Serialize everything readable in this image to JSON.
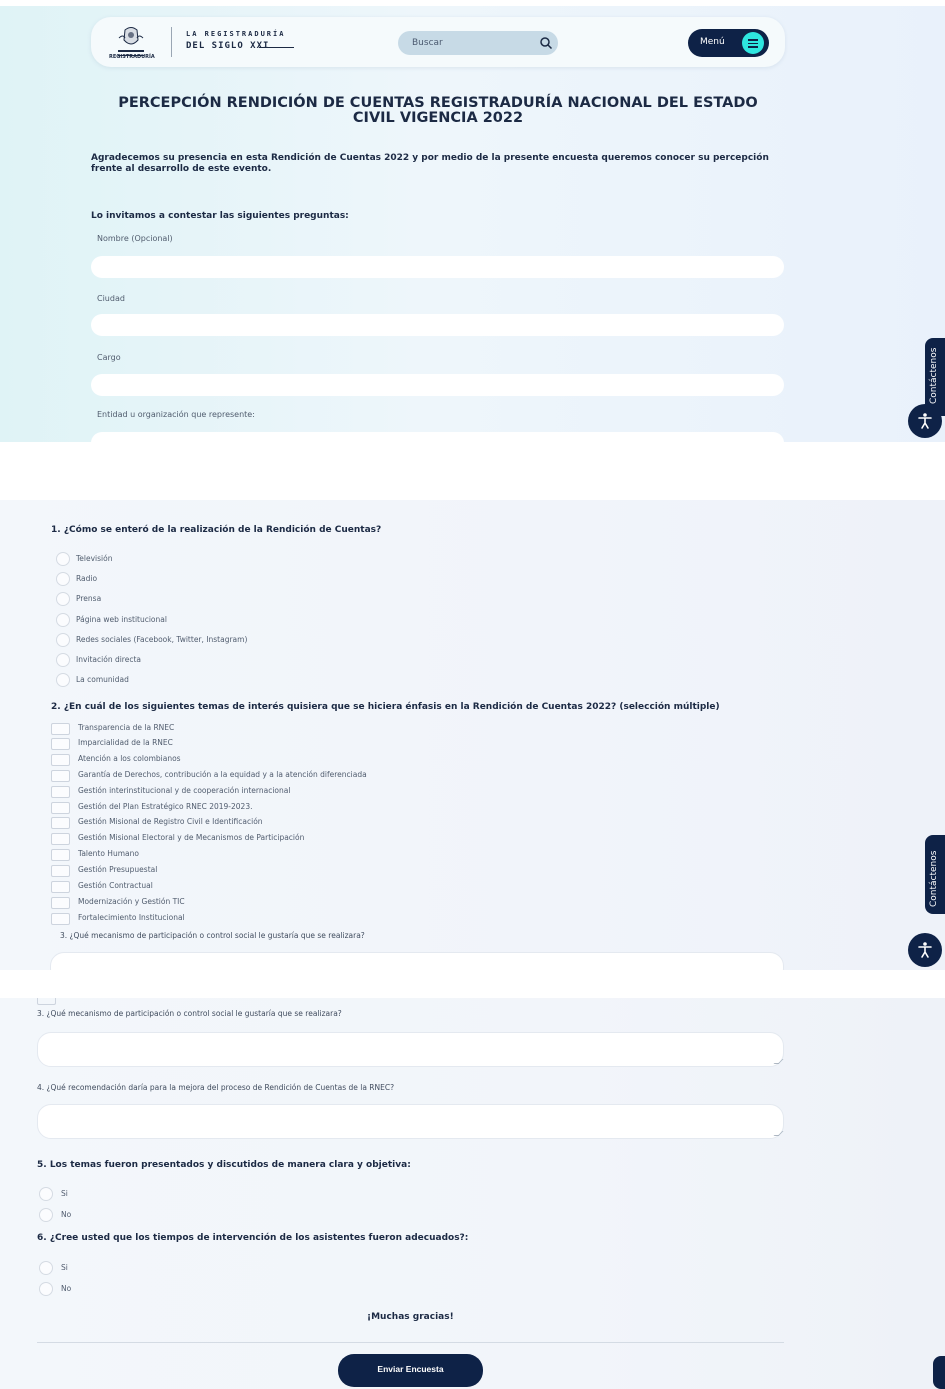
{
  "header": {
    "logo_small_text": "REGISTRADURÍA",
    "logo_line1": "LA REGISTRADURÍA",
    "logo_line2": "DEL SIGLO XXI",
    "search_placeholder": "Buscar",
    "menu_label": "Menú"
  },
  "page": {
    "title": "PERCEPCIÓN RENDICIÓN DE CUENTAS REGISTRADURÍA NACIONAL DEL ESTADO CIVIL VIGENCIA 2022",
    "intro": "Agradecemos su presencia en esta Rendición de Cuentas 2022 y por medio de la presente encuesta queremos conocer su percepción frente al desarrollo de este evento.",
    "invite": "Lo invitamos a contestar las siguientes preguntas:"
  },
  "fields": {
    "name": "Nombre (Opcional)",
    "city": "Ciudad",
    "position": "Cargo",
    "entity": "Entidad u organización que represente:"
  },
  "side": {
    "contact_label": "Contáctenos"
  },
  "q1": {
    "title": "1. ¿Cómo se enteró de la realización de la Rendición de Cuentas?",
    "options": [
      "Televisión",
      "Radio",
      "Prensa",
      "Página web institucional",
      "Redes sociales (Facebook, Twitter, Instagram)",
      "Invitación directa",
      "La comunidad"
    ]
  },
  "q2": {
    "title": "2. ¿En cuál de los siguientes temas de interés quisiera que se hiciera énfasis en la Rendición de Cuentas 2022? (selección múltiple)",
    "options": [
      "Transparencia de la RNEC",
      "Imparcialidad de la RNEC",
      "Atención a los colombianos",
      "Garantía de Derechos, contribución a la equidad y a la atención diferenciada",
      "Gestión interinstitucional y de cooperación internacional",
      "Gestión del Plan Estratégico RNEC 2019-2023.",
      "Gestión Misional de Registro Civil e Identificación",
      "Gestión Misional Electoral y de Mecanismos de Participación",
      "Talento Humano",
      "Gestión Presupuestal",
      "Gestión Contractual",
      "Modernización y Gestión TIC",
      "Fortalecimiento Institucional"
    ]
  },
  "q3": {
    "title": "3. ¿Qué mecanismo de participación o control social le gustaría que se realizara?"
  },
  "q4": {
    "title": "4. ¿Qué recomendación daría para la mejora del proceso de Rendición de Cuentas de la RNEC?"
  },
  "q5": {
    "title": "5. Los temas fueron presentados y discutidos de manera clara y objetiva:",
    "options": [
      "Si",
      "No"
    ]
  },
  "q6": {
    "title": "6. ¿Cree usted que los tiempos de intervención de los asistentes fueron adecuados?:",
    "options": [
      "Si",
      "No"
    ]
  },
  "footer": {
    "thanks": "¡Muchas gracias!",
    "submit_label": "Enviar Encuesta"
  },
  "colors": {
    "navy": "#0e2247",
    "accent": "#2ee6e0"
  }
}
